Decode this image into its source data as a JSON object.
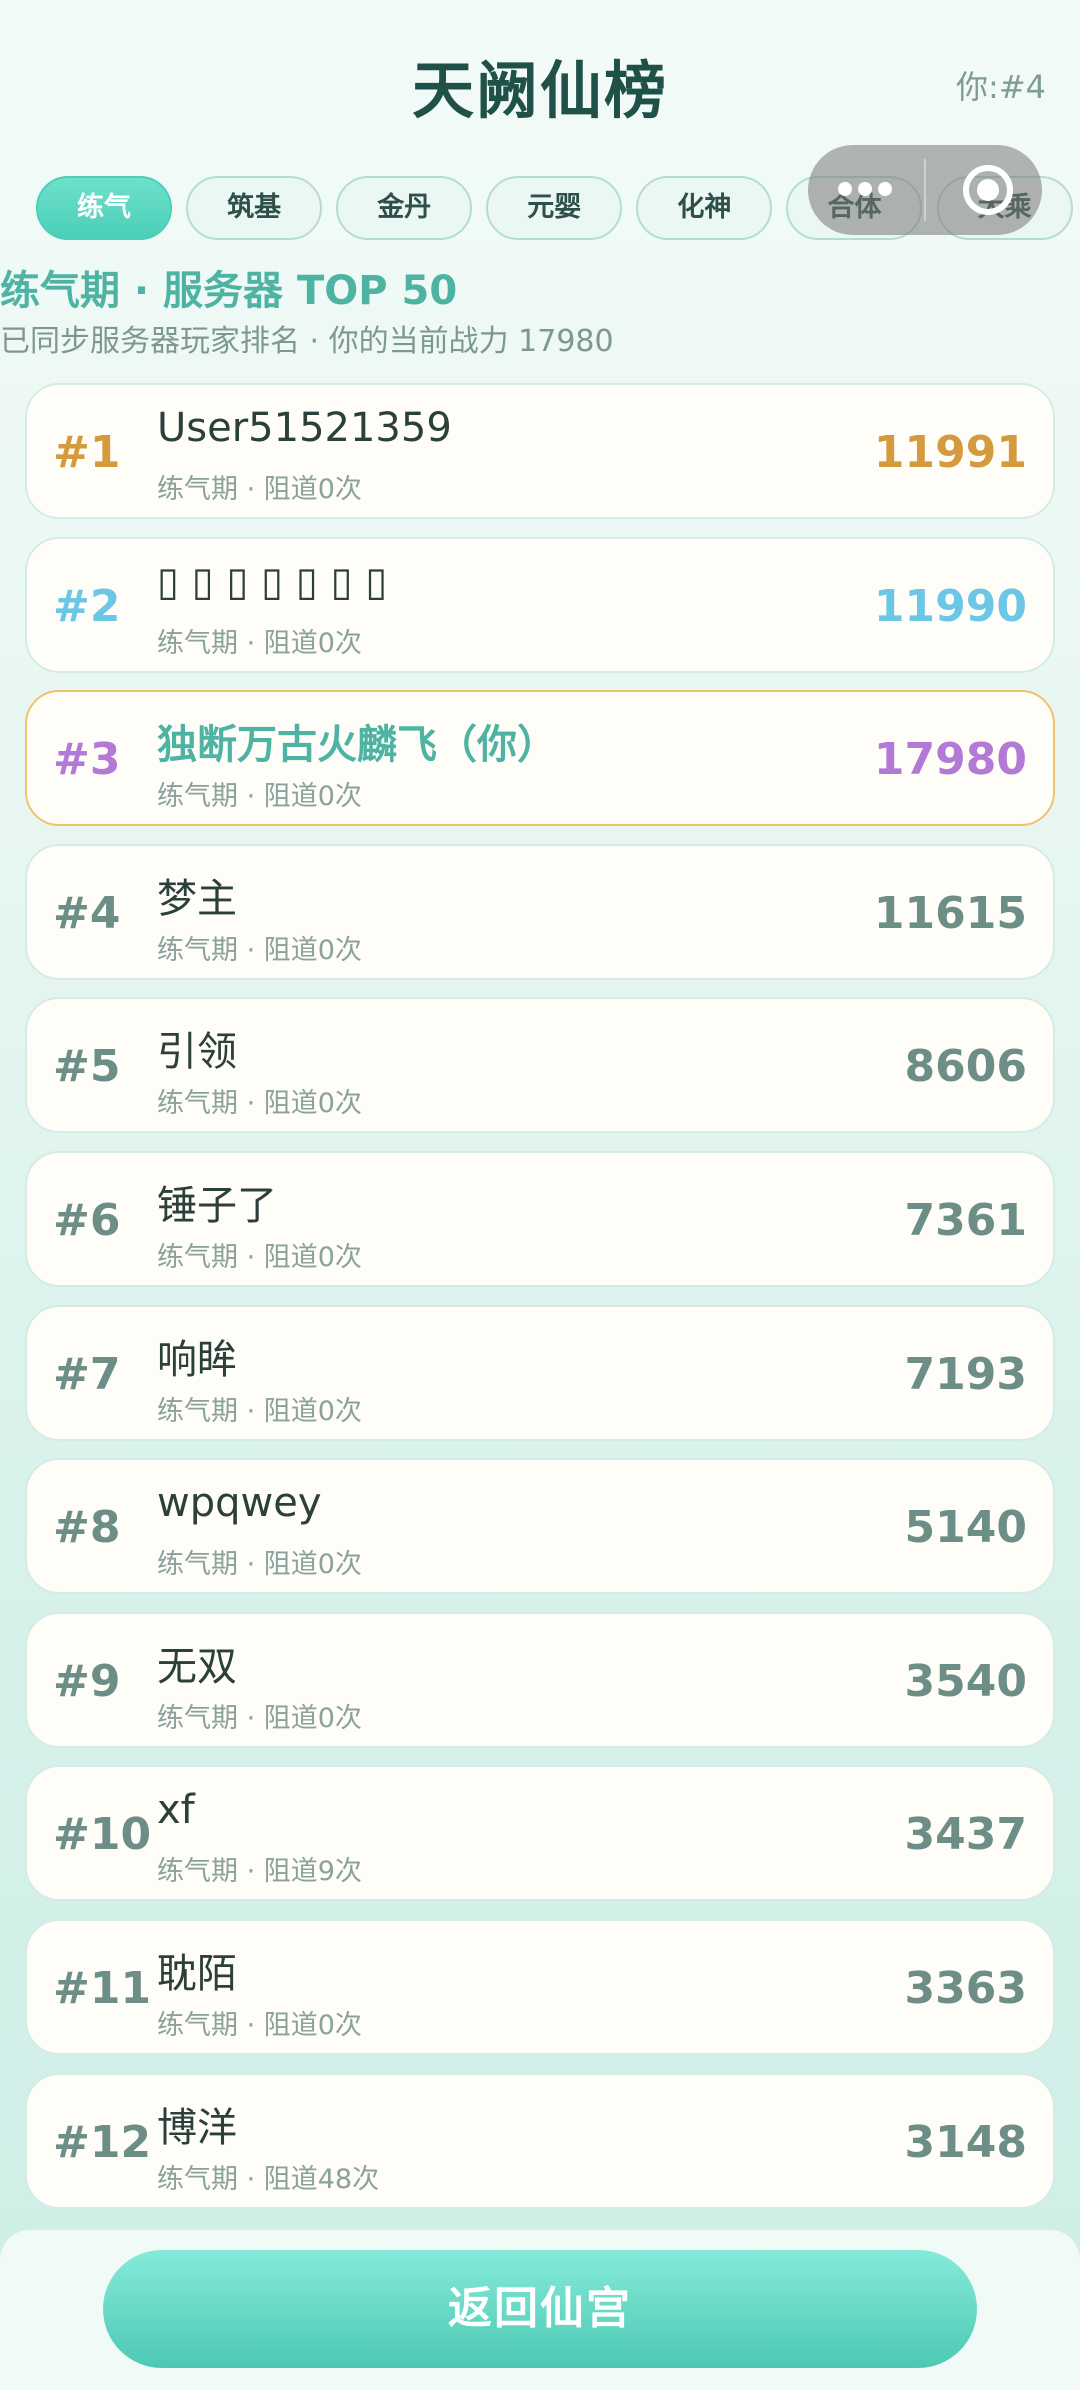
{
  "header": {
    "title": "天阙仙榜",
    "my_rank": "你:#4"
  },
  "tabs": [
    {
      "label": "练气",
      "active": true
    },
    {
      "label": "筑基",
      "active": false
    },
    {
      "label": "金丹",
      "active": false
    },
    {
      "label": "元婴",
      "active": false
    },
    {
      "label": "化神",
      "active": false
    },
    {
      "label": "合体",
      "active": false
    },
    {
      "label": "大乘",
      "active": false
    }
  ],
  "section": {
    "title": "练气期 · 服务器 TOP 50",
    "subtitle": "已同步服务器玩家排名 · 你的当前战力 17980"
  },
  "rows": [
    {
      "rank": "#1",
      "name": "User51521359",
      "meta": "练气期 · 阻道0次",
      "power": "11991"
    },
    {
      "rank": "#2",
      "name": "▯ ▯ ▯ ▯ ▯ ▯ ▯",
      "meta": "练气期 · 阻道0次",
      "power": "11990"
    },
    {
      "rank": "#3",
      "name": "独断万古火麟飞（你）",
      "meta": "练气期 · 阻道0次",
      "power": "17980"
    },
    {
      "rank": "#4",
      "name": "梦主",
      "meta": "练气期 · 阻道0次",
      "power": "11615"
    },
    {
      "rank": "#5",
      "name": "引领",
      "meta": "练气期 · 阻道0次",
      "power": "8606"
    },
    {
      "rank": "#6",
      "name": "锤子了",
      "meta": "练气期 · 阻道0次",
      "power": "7361"
    },
    {
      "rank": "#7",
      "name": "响眸",
      "meta": "练气期 · 阻道0次",
      "power": "7193"
    },
    {
      "rank": "#8",
      "name": "wpqwey",
      "meta": "练气期 · 阻道0次",
      "power": "5140"
    },
    {
      "rank": "#9",
      "name": "无双",
      "meta": "练气期 · 阻道0次",
      "power": "3540"
    },
    {
      "rank": "#10",
      "name": "xf",
      "meta": "练气期 · 阻道9次",
      "power": "3437"
    },
    {
      "rank": "#11",
      "name": "耽陌",
      "meta": "练气期 · 阻道0次",
      "power": "3363"
    },
    {
      "rank": "#12",
      "name": "博洋",
      "meta": "练气期 · 阻道48次",
      "power": "3148"
    }
  ],
  "footer": {
    "back_label": "返回仙宫"
  },
  "colors": {
    "accent": "#4eb3a3",
    "rank1": "#d49a3e",
    "rank2": "#6cc6e6",
    "rank3": "#b27ad6"
  },
  "icons": {
    "capsule_menu": "more-dots-icon",
    "capsule_close": "close-target-icon"
  }
}
